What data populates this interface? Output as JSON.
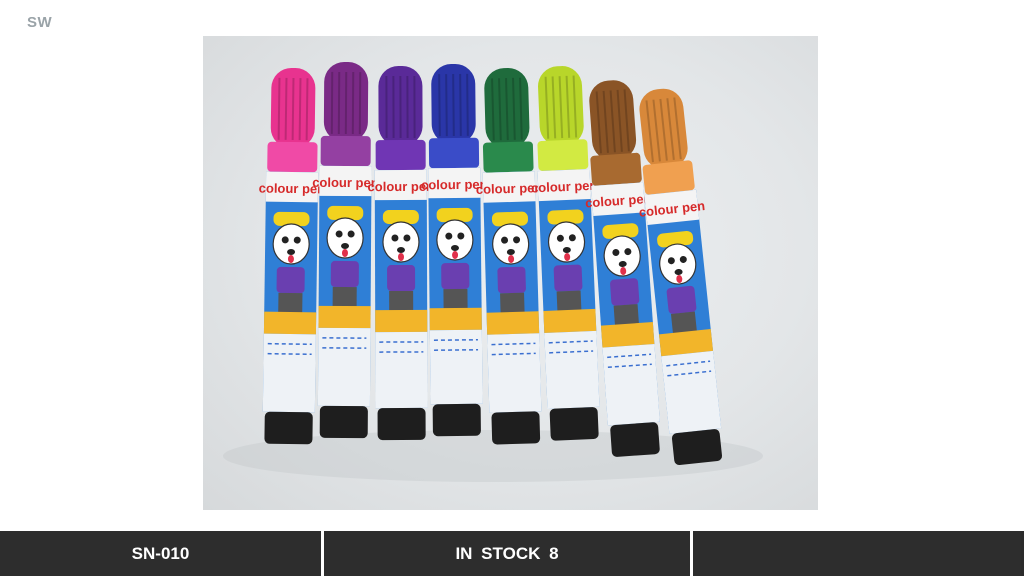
{
  "brand": "SW",
  "product_image": {
    "pens": [
      {
        "cap_color": "#e8338f",
        "band_color": "#f04aa6"
      },
      {
        "cap_color": "#7a2a86",
        "band_color": "#9440a2"
      },
      {
        "cap_color": "#5a2a98",
        "band_color": "#7036b4"
      },
      {
        "cap_color": "#2a36a8",
        "band_color": "#3a4cc8"
      },
      {
        "cap_color": "#1f6b3c",
        "band_color": "#2a8a4c"
      },
      {
        "cap_color": "#b8d62a",
        "band_color": "#d2ea42"
      },
      {
        "cap_color": "#8a5426",
        "band_color": "#a86a30"
      },
      {
        "cap_color": "#d8883a",
        "band_color": "#f0a050"
      }
    ],
    "label_text": "colour pen"
  },
  "footer": {
    "sku": "SN-010",
    "stock": "IN STOCK 8",
    "extra": ""
  }
}
